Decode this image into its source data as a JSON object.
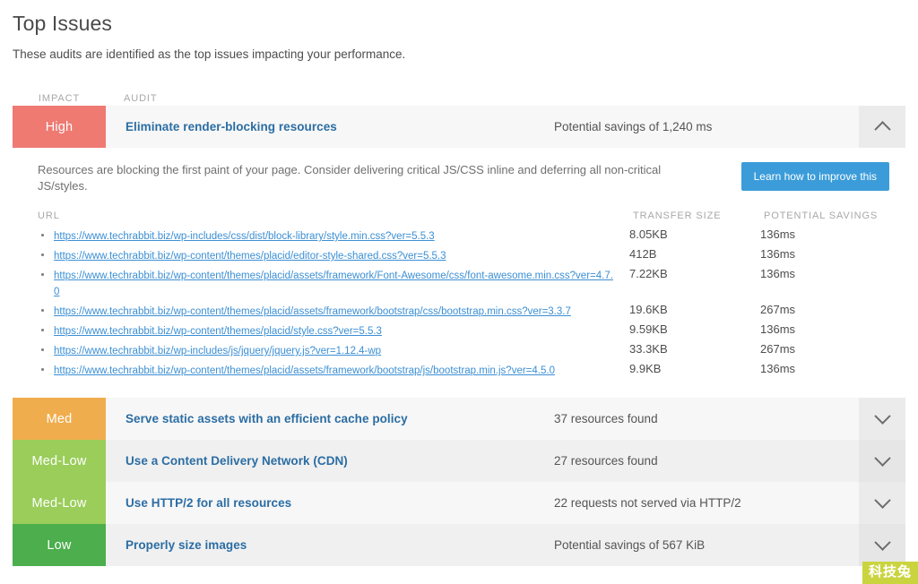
{
  "header": {
    "title": "Top Issues",
    "subtitle": "These audits are identified as the top issues impacting your performance."
  },
  "table": {
    "col_impact": "IMPACT",
    "col_audit": "AUDIT"
  },
  "colors": {
    "high": "#ee7a72",
    "med": "#f0ad4e",
    "med_low": "#9acd5a",
    "low": "#4cae4c",
    "link": "#2b6da3",
    "button": "#3b9cd9"
  },
  "issues": [
    {
      "impact": "High",
      "impact_level": "high",
      "title": "Eliminate render-blocking resources",
      "metric": "Potential savings of 1,240 ms",
      "expanded": true,
      "chevron": "chevron-up"
    },
    {
      "impact": "Med",
      "impact_level": "med",
      "title": "Serve static assets with an efficient cache policy",
      "metric": "37 resources found",
      "expanded": false,
      "chevron": "chevron-down"
    },
    {
      "impact": "Med-Low",
      "impact_level": "med_low",
      "title": "Use a Content Delivery Network (CDN)",
      "metric": "27 resources found",
      "expanded": false,
      "chevron": "chevron-down"
    },
    {
      "impact": "Med-Low",
      "impact_level": "med_low",
      "title": "Use HTTP/2 for all resources",
      "metric": "22 requests not served via HTTP/2",
      "expanded": false,
      "chevron": "chevron-down"
    },
    {
      "impact": "Low",
      "impact_level": "low",
      "title": "Properly size images",
      "metric": "Potential savings of 567 KiB",
      "expanded": false,
      "chevron": "chevron-down"
    }
  ],
  "detail": {
    "description": "Resources are blocking the first paint of your page. Consider delivering critical JS/CSS inline and deferring all non-critical JS/styles.",
    "learn_button": "Learn how to improve this",
    "columns": {
      "url": "URL",
      "transfer_size": "TRANSFER SIZE",
      "potential_savings": "POTENTIAL SAVINGS"
    },
    "rows": [
      {
        "url": "https://www.techrabbit.biz/wp-includes/css/dist/block-library/style.min.css?ver=5.5.3",
        "transfer_size": "8.05KB",
        "potential_savings": "136ms"
      },
      {
        "url": "https://www.techrabbit.biz/wp-content/themes/placid/editor-style-shared.css?ver=5.5.3",
        "transfer_size": "412B",
        "potential_savings": "136ms"
      },
      {
        "url": "https://www.techrabbit.biz/wp-content/themes/placid/assets/framework/Font-Awesome/css/font-awesome.min.css?ver=4.7.0",
        "transfer_size": "7.22KB",
        "potential_savings": "136ms"
      },
      {
        "url": "https://www.techrabbit.biz/wp-content/themes/placid/assets/framework/bootstrap/css/bootstrap.min.css?ver=3.3.7",
        "transfer_size": "19.6KB",
        "potential_savings": "267ms"
      },
      {
        "url": "https://www.techrabbit.biz/wp-content/themes/placid/style.css?ver=5.5.3",
        "transfer_size": "9.59KB",
        "potential_savings": "136ms"
      },
      {
        "url": "https://www.techrabbit.biz/wp-includes/js/jquery/jquery.js?ver=1.12.4-wp",
        "transfer_size": "33.3KB",
        "potential_savings": "267ms"
      },
      {
        "url": "https://www.techrabbit.biz/wp-content/themes/placid/assets/framework/bootstrap/js/bootstrap.min.js?ver=4.5.0",
        "transfer_size": "9.9KB",
        "potential_savings": "136ms"
      }
    ]
  },
  "watermark": {
    "text": "科技兔"
  }
}
